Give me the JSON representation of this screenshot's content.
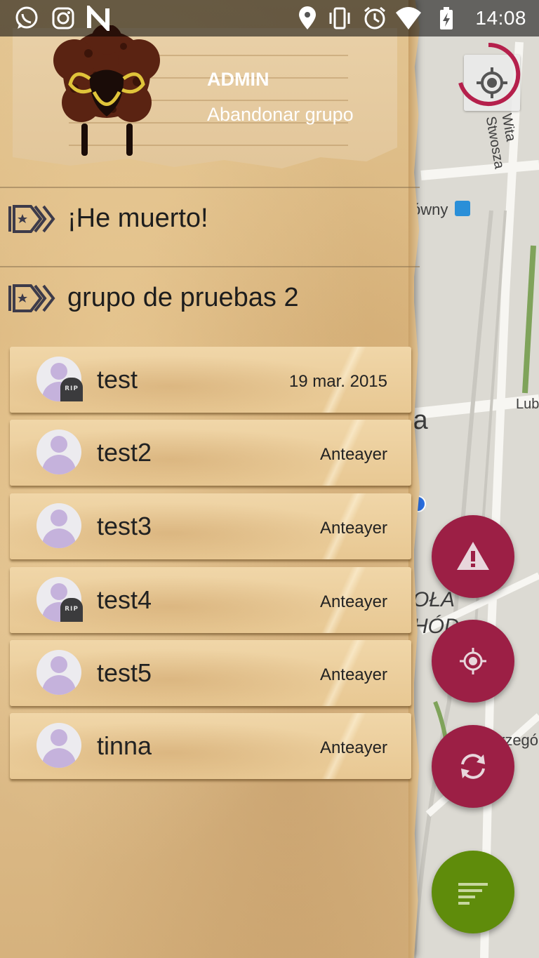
{
  "status_bar": {
    "time": "14:08",
    "left_icons": [
      "whatsapp-icon",
      "instagram-icon",
      "n-app-icon"
    ],
    "right_icons": [
      "location-icon",
      "vibrate-icon",
      "alarm-icon",
      "wifi-icon",
      "battery-charging-icon"
    ]
  },
  "map": {
    "labels": {
      "street_1": "Wita Stwosza",
      "station": "Główny",
      "street_2": "Lub",
      "area_1": "ia",
      "area_2": "OŁA",
      "area_3": "HÓD",
      "street_3": "rzegó"
    }
  },
  "drawer": {
    "header": {
      "role": "ADMIN",
      "leave_group": "Abandonar grupo"
    },
    "groups": [
      {
        "title": "¡He muerto!"
      },
      {
        "title": "grupo de pruebas 2"
      }
    ],
    "members": [
      {
        "name": "test",
        "date": "19 mar. 2015",
        "dead": true
      },
      {
        "name": "test2",
        "date": "Anteayer",
        "dead": false
      },
      {
        "name": "test3",
        "date": "Anteayer",
        "dead": false
      },
      {
        "name": "test4",
        "date": "Anteayer",
        "dead": true
      },
      {
        "name": "test5",
        "date": "Anteayer",
        "dead": false
      },
      {
        "name": "tinna",
        "date": "Anteayer",
        "dead": false
      }
    ],
    "rip_label": "RIP"
  },
  "fabs": {
    "alert_color": "#9c1f45",
    "target_color": "#9c1f45",
    "refresh_color": "#9c1f45",
    "list_color": "#5f8c0b"
  }
}
